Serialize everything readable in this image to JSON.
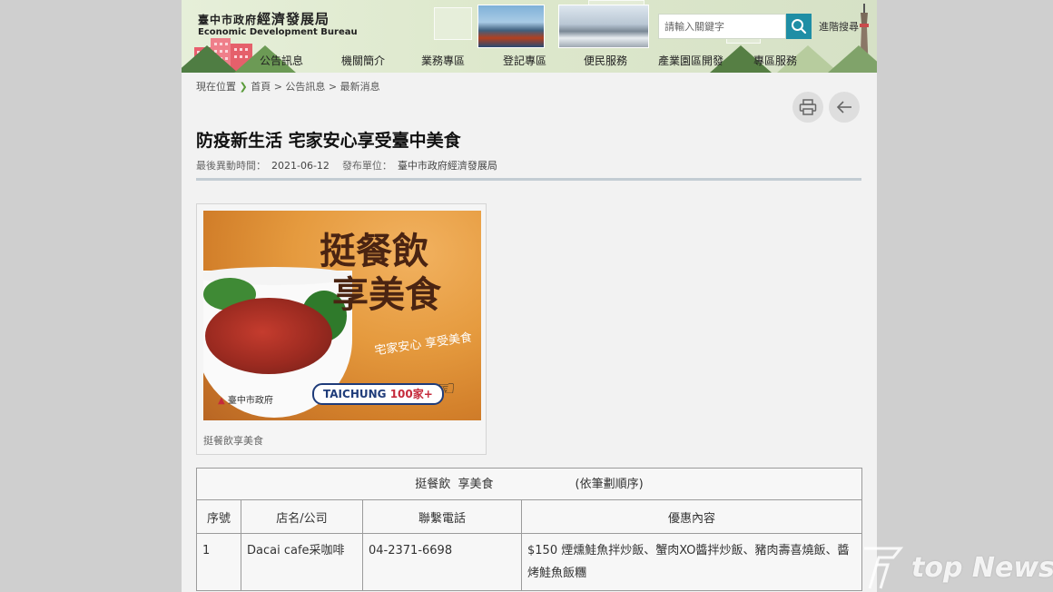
{
  "header": {
    "logo_cn_prefix": "臺中市政府",
    "logo_cn_main": "經濟發展局",
    "logo_en": "Economic Development Bureau",
    "search_placeholder": "請輸入關鍵字",
    "advanced_search": "進階搜尋"
  },
  "nav": {
    "items": [
      "公告訊息",
      "機關簡介",
      "業務專區",
      "登記專區",
      "便民服務",
      "產業園區開發",
      "專區服務"
    ]
  },
  "breadcrumb": {
    "label": "現在位置",
    "path": "首頁 > 公告訊息 > 最新消息"
  },
  "article": {
    "title": "防疫新生活 宅家安心享受臺中美食",
    "updated_label": "最後異動時間：",
    "updated_value": "2021-06-12",
    "publisher_label": "發布單位：",
    "publisher_value": "臺中市政府經濟發展局"
  },
  "figure": {
    "poster_line1": "挺餐飲",
    "poster_line2": "享美食",
    "poster_subtitle": "宅家安心 享受美食",
    "poster_badge_en": "TAICHUNG",
    "poster_badge_num": "100家+",
    "poster_gov": "臺中市政府",
    "caption": "挺餐飲享美食"
  },
  "table": {
    "caption_title": "挺餐飲  享美食",
    "caption_note": "(依筆劃順序)",
    "headers": [
      "序號",
      "店名/公司",
      "聯繫電話",
      "優惠內容"
    ],
    "rows": [
      {
        "no": "1",
        "name": "Dacai cafe采咖啡",
        "phone": "04-2371-6698",
        "offer": "$150 煙燻鮭魚拌炒飯、蟹肉XO醬拌炒飯、豬肉壽喜燒飯、醬烤鮭魚飯糰"
      }
    ]
  },
  "watermark": {
    "text": "top News"
  },
  "colors": {
    "search_button": "#1f8ea5",
    "divider": "#c3ccd3",
    "breadcrumb_arrow": "#5a9b3a"
  }
}
